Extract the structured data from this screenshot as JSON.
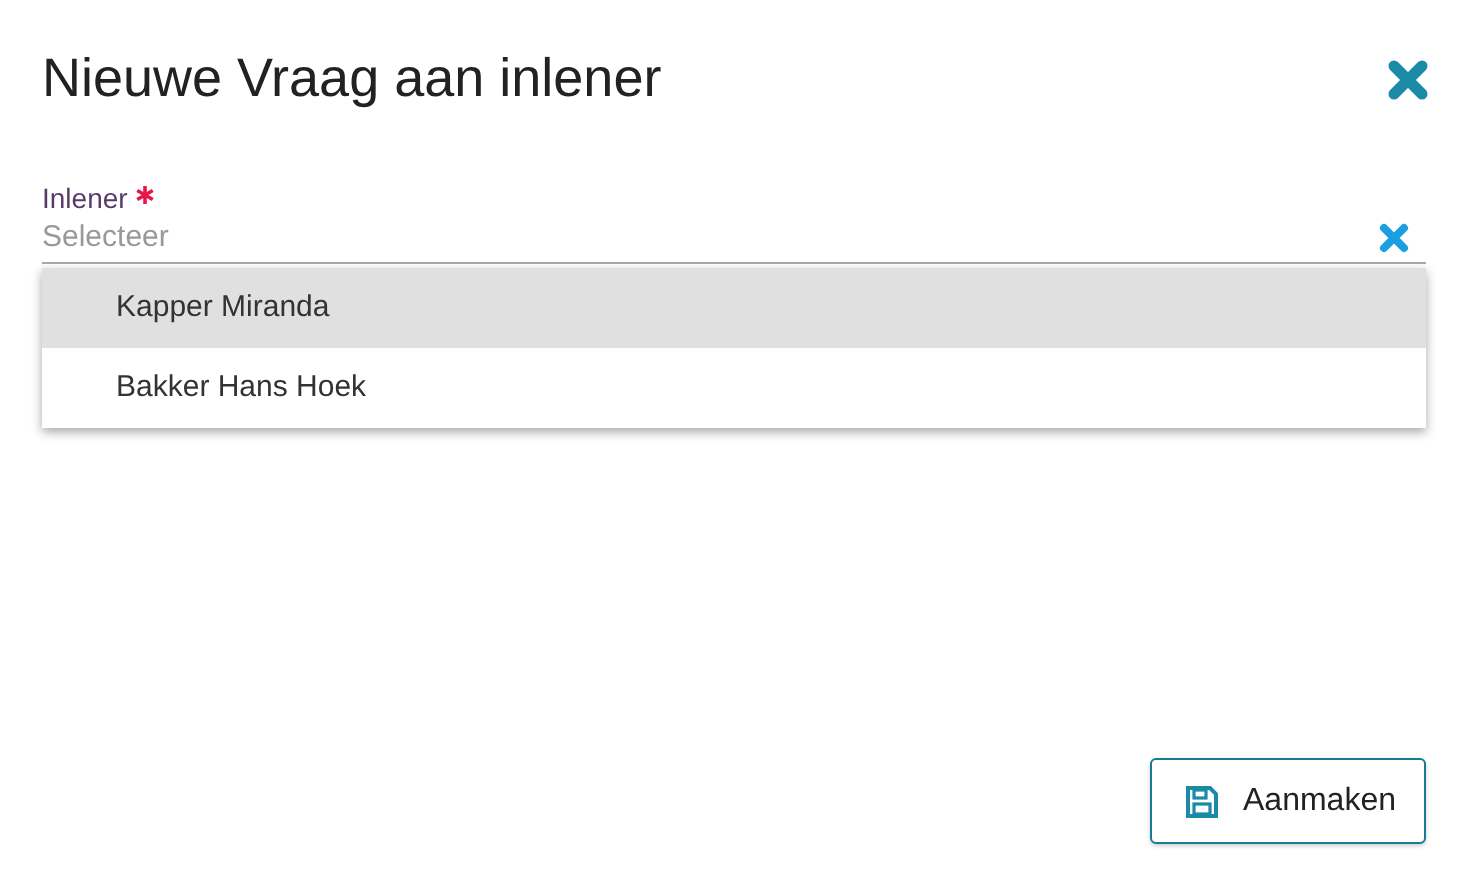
{
  "dialog": {
    "title": "Nieuwe Vraag aan inlener"
  },
  "field": {
    "label": "Inlener",
    "required": true,
    "placeholder": "Selecteer",
    "expanded": true
  },
  "options": [
    {
      "label": "Kapper Miranda",
      "selected": true
    },
    {
      "label": "Bakker Hans Hoek",
      "selected": false
    }
  ],
  "buttons": [
    {
      "label": "Aanmaken"
    }
  ]
}
